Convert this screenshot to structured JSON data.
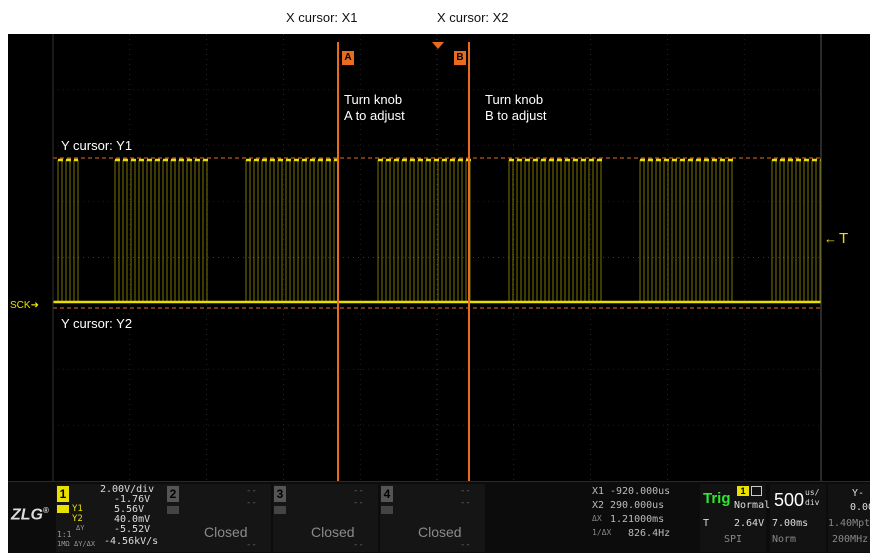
{
  "top": {
    "x1_label": "X cursor: X1",
    "x2_label": "X cursor: X2"
  },
  "annotations": {
    "y1_label": "Y cursor: Y1",
    "y2_label": "Y cursor: Y2",
    "knob_a_line1": "Turn knob",
    "knob_a_line2": "A to adjust",
    "knob_b_line1": "Turn knob",
    "knob_b_line2": "B to adjust",
    "marker_a": "A",
    "marker_b": "B",
    "trigger_marker": "T",
    "sck_label": "SCK"
  },
  "colors": {
    "signal": "#e8e000",
    "cursor": "#e86b1e",
    "grid": "#3a3a3a",
    "trig_green": "#2ee82e"
  },
  "logo": "ZLG",
  "channel1": {
    "number": "1",
    "scale": "2.00V/div",
    "offset": "-1.76V",
    "y1_label": "Y1",
    "y1_value": "5.56V",
    "y2_label": "Y2",
    "y2_value": "40.0mV",
    "dy_value": "-5.52V",
    "rate_value": "-4.56kV/s",
    "dy_label": "ΔY",
    "ratio_label": "1:1",
    "coupling_label": "1MΩ",
    "ratio_symbol": "ΔY/ΔX"
  },
  "channels": [
    {
      "number": "2",
      "status": "Closed",
      "dash": "--"
    },
    {
      "number": "3",
      "status": "Closed",
      "dash": "--"
    },
    {
      "number": "4",
      "status": "Closed",
      "dash": "--"
    }
  ],
  "cursor_readout": {
    "x1_label": "X1",
    "x1_value": "-920.000us",
    "x2_label": "X2",
    "x2_value": "290.000us",
    "dx_label": "ΔX",
    "dx_value": "1.21000ms",
    "inv_label": "1/ΔX",
    "inv_value": "826.4Hz"
  },
  "trigger": {
    "label": "Trig",
    "channel": "1",
    "mode": "Normal",
    "type": "T",
    "level": "2.64V",
    "protocol": "SPI"
  },
  "timebase": {
    "value": "500",
    "unit_top": "us/",
    "unit_bottom": "div",
    "delay": "7.00ms",
    "mode": "Norm"
  },
  "acquisition": {
    "label": "Y-",
    "value": "0.00",
    "memory": "1.40Mpt",
    "bandwidth": "200MHz"
  }
}
